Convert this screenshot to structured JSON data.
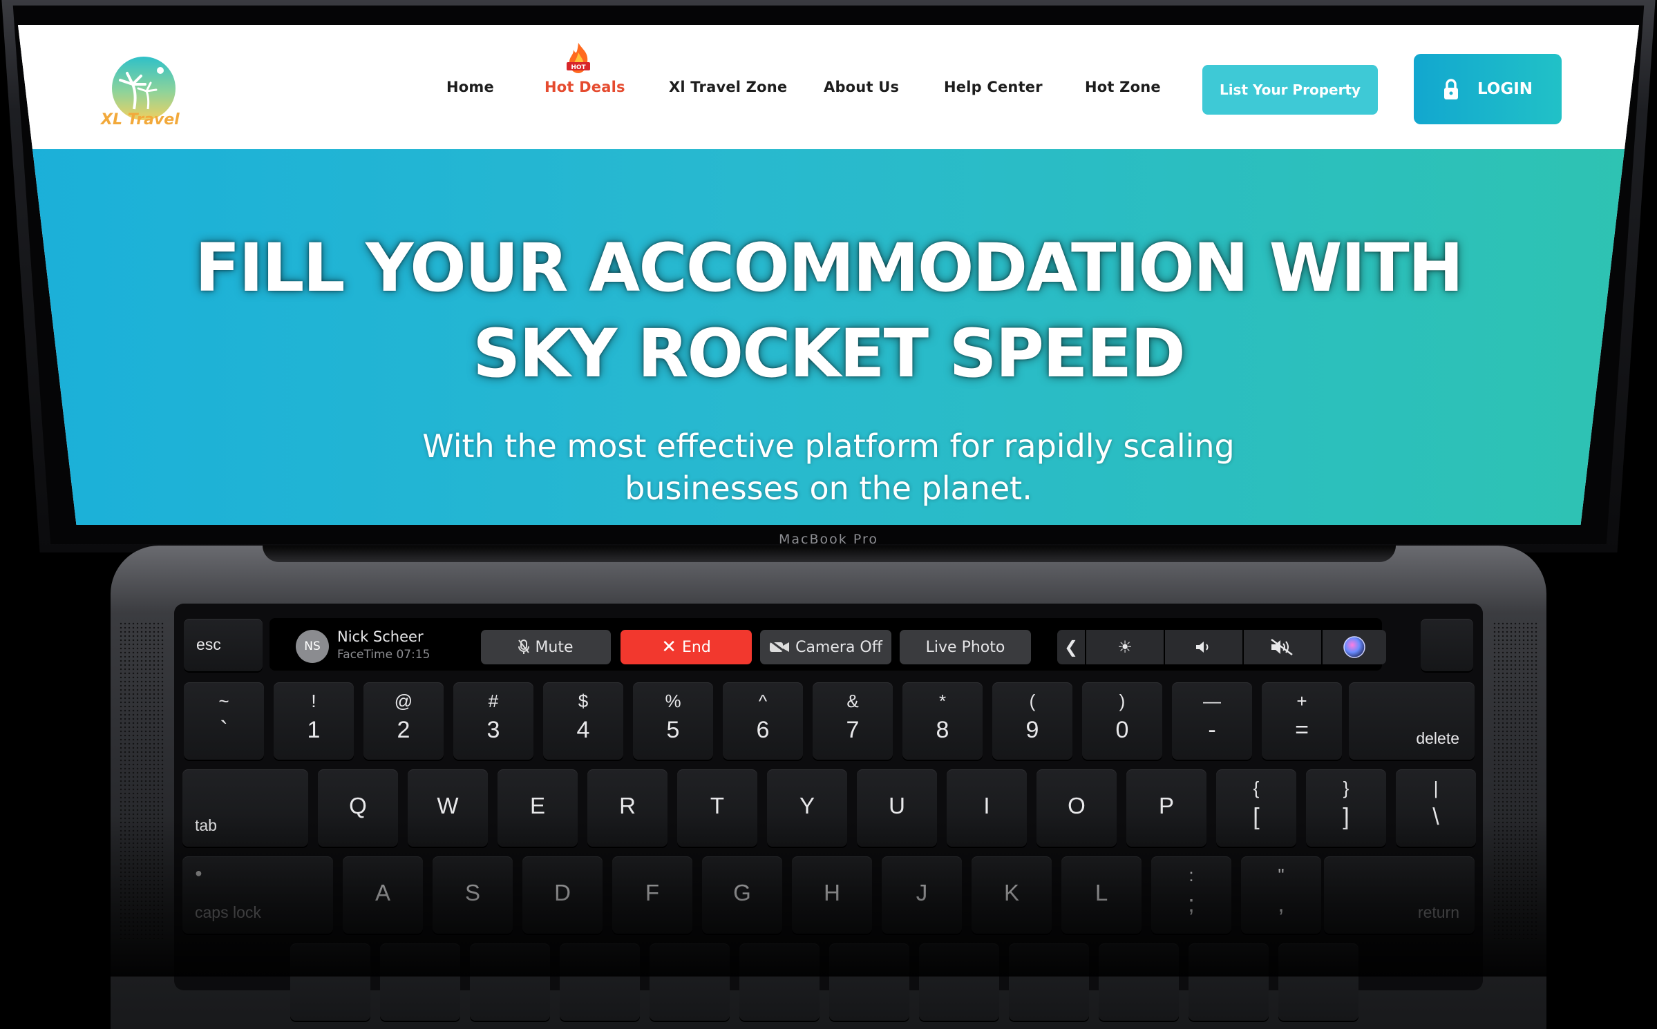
{
  "website": {
    "logo_text": "XL Travel",
    "logo_tagline": "",
    "nav": {
      "home": "Home",
      "hot_deals": "Hot Deals",
      "travel_zone": "Xl Travel Zone",
      "about": "About Us",
      "help": "Help Center",
      "hot_zone": "Hot Zone"
    },
    "list_property": "List Your Property",
    "login": "LOGIN",
    "hero": {
      "title_line1": "FILL YOUR ACCOMMODATION WITH",
      "title_line2": "SKY ROCKET SPEED",
      "subtitle_line1": "With the most effective platform for rapidly scaling",
      "subtitle_line2": "businesses on the planet."
    },
    "colors": {
      "hero_gradient_start": "#1bb0d9",
      "hero_gradient_end": "#2ec3b2",
      "hot_deals": "#e54b2f",
      "list_button": "#3ec9d6",
      "login_button": "#12a7cf"
    }
  },
  "laptop": {
    "model_label": "MacBook Pro",
    "touch_bar": {
      "avatar_initials": "NS",
      "caller_name": "Nick Scheer",
      "call_status": "FaceTime 07:15",
      "mute": "Mute",
      "end": "End",
      "camera_off": "Camera Off",
      "live_photo": "Live Photo",
      "icons": [
        "chevron-left-icon",
        "brightness-icon",
        "volume-icon",
        "mute-volume-icon",
        "siri-icon"
      ]
    },
    "keys": {
      "esc": "esc",
      "delete": "delete",
      "tab": "tab",
      "caps_lock": "caps lock",
      "return": "return",
      "number_row": [
        {
          "top": "~",
          "bottom": "`"
        },
        {
          "top": "!",
          "bottom": "1"
        },
        {
          "top": "@",
          "bottom": "2"
        },
        {
          "top": "#",
          "bottom": "3"
        },
        {
          "top": "$",
          "bottom": "4"
        },
        {
          "top": "%",
          "bottom": "5"
        },
        {
          "top": "^",
          "bottom": "6"
        },
        {
          "top": "&",
          "bottom": "7"
        },
        {
          "top": "*",
          "bottom": "8"
        },
        {
          "top": "(",
          "bottom": "9"
        },
        {
          "top": ")",
          "bottom": "0"
        },
        {
          "top": "—",
          "bottom": "-"
        },
        {
          "top": "+",
          "bottom": "="
        }
      ],
      "qwerty_row": [
        "Q",
        "W",
        "E",
        "R",
        "T",
        "Y",
        "U",
        "I",
        "O",
        "P"
      ],
      "brackets": [
        {
          "top": "{",
          "bottom": "["
        },
        {
          "top": "}",
          "bottom": "]"
        },
        {
          "top": "|",
          "bottom": "\\"
        }
      ],
      "home_row": [
        "A",
        "S",
        "D",
        "F",
        "G",
        "H",
        "J",
        "K",
        "L"
      ],
      "home_punct": [
        {
          "top": ":",
          "bottom": ";"
        },
        {
          "top": "\"",
          "bottom": ","
        }
      ]
    }
  }
}
